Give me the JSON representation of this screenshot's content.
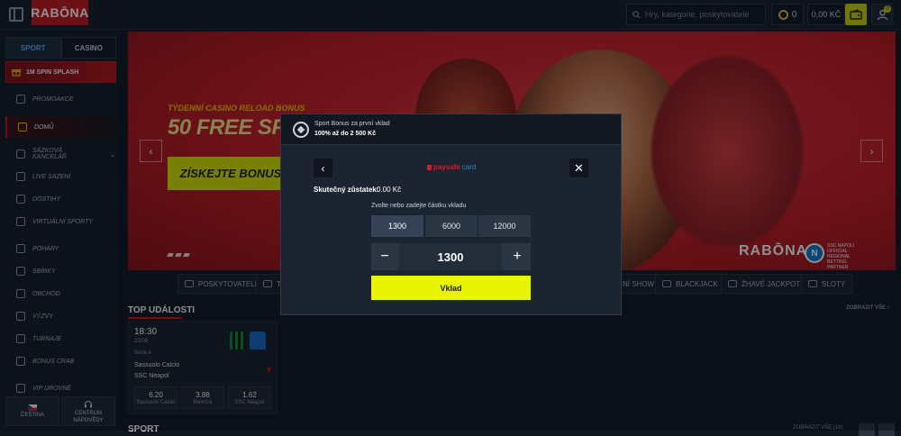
{
  "header": {
    "logo": "RABŌNA",
    "search_placeholder": "Hry, kategorie, poskytovatelé",
    "coins": "0",
    "balance": "0,00 KČ",
    "profile_badge": "0"
  },
  "sidebar": {
    "tabs": [
      {
        "label": "SPORT",
        "active": true
      },
      {
        "label": "CASINO",
        "active": false
      }
    ],
    "promo": "1M SPIN SPLASH",
    "items": [
      {
        "label": "PROMOAKCE",
        "icon": "gift-icon"
      },
      {
        "label": "DOMŮ",
        "icon": "home-icon",
        "active": true
      },
      {
        "label": "SÁZKOVÁ KANCELÁŘ",
        "icon": "ticket-icon"
      },
      {
        "label": "LIVE SÁZENÍ",
        "icon": "live-icon"
      },
      {
        "label": "DOSTIHY",
        "icon": "horse-icon"
      },
      {
        "label": "VIRTUÁLNÍ SPORTY",
        "icon": "virtual-icon"
      },
      {
        "label": "POHÁRY",
        "icon": "trophy-icon"
      },
      {
        "label": "SBÍRKY",
        "icon": "collection-icon"
      },
      {
        "label": "OBCHOD",
        "icon": "cart-icon"
      },
      {
        "label": "VÝZVY",
        "icon": "flag-icon"
      },
      {
        "label": "TURNAJE",
        "icon": "trophy-icon"
      },
      {
        "label": "BONUS CRAB",
        "icon": "crab-icon"
      },
      {
        "label": "VIP ÚROVNĚ",
        "icon": "vip-icon"
      }
    ],
    "language": "ČEŠTINA",
    "help_line1": "CENTRUM",
    "help_line2": "NÁPOVĚDY"
  },
  "hero": {
    "eyebrow": "TÝDENNÍ CASINO RELOAD BONUS",
    "title": "50 FREE SPIN",
    "cta": "ZÍSKEJTE BONUS",
    "brand_mark": "RABŌNA",
    "partner": "SSC NAPOLI OFFICIAL REGIONAL BETTING PARTNER"
  },
  "categories": [
    {
      "label": "POSKYTOVATELÉ"
    },
    {
      "label": "T"
    },
    {
      "label": "NÍ SHOW"
    },
    {
      "label": "BLACKJACK"
    },
    {
      "label": "ŽHAVÉ JACKPOTY"
    },
    {
      "label": "SLOTY"
    }
  ],
  "top_events": {
    "title": "TOP UDÁLOSTI",
    "show_all": "ZOBRAZIT VŠE",
    "event": {
      "time": "18:30",
      "date": "23/08",
      "league": "Serie A",
      "home": "Sassuolo Calcio",
      "away": "SSC Neapol",
      "odds": [
        {
          "value": "6.20",
          "label": "Sassuolo Calcio"
        },
        {
          "value": "3.88",
          "label": "Remíza"
        },
        {
          "value": "1.62",
          "label": "SSC Neapol"
        }
      ]
    }
  },
  "sport_section": {
    "title": "SPORT",
    "show_all": "ZOBRAZIT VŠE (18)"
  },
  "modal": {
    "header_line1": "Sport Bonus za první vklad",
    "header_line2": "100% až do 2 500 Kč",
    "provider": "paysafe",
    "provider_suffix": "card",
    "balance_label": "Skutečný zůstatek:",
    "balance_value": "0.00 Kč",
    "prompt": "Zvolte nebo zadejte částku vkladu",
    "amounts": [
      "1300",
      "6000",
      "12000"
    ],
    "selected_amount": "1300",
    "input_value": "1300",
    "deposit_label": "Vklad"
  }
}
